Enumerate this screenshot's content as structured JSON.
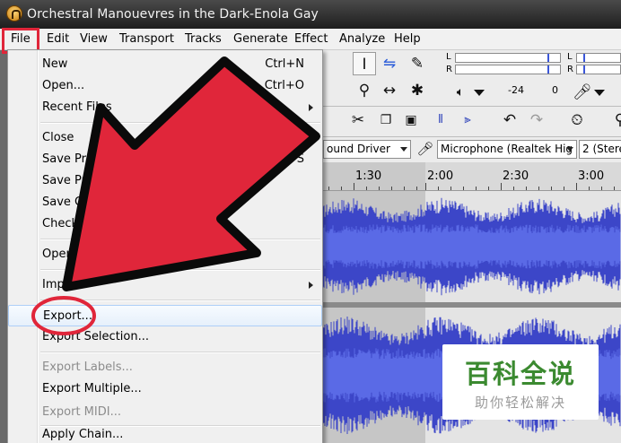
{
  "window": {
    "title": "Orchestral Manouevres in the Dark-Enola Gay"
  },
  "menubar": {
    "items": [
      "File",
      "Edit",
      "View",
      "Transport",
      "Tracks",
      "Generate",
      "Effect",
      "Analyze",
      "Help"
    ]
  },
  "file_menu": {
    "items": [
      {
        "label": "New",
        "shortcut": "Ctrl+N",
        "enabled": true
      },
      {
        "label": "Open...",
        "shortcut": "Ctrl+O",
        "enabled": true
      },
      {
        "label": "Recent Files",
        "submenu": true,
        "enabled": true
      },
      {
        "label": "Close",
        "shortcut": "Ctrl+W",
        "enabled": true
      },
      {
        "label": "Save Project",
        "shortcut": "Ctrl+S",
        "enabled": true
      },
      {
        "label": "Save Proje",
        "enabled": true
      },
      {
        "label": "Save Com",
        "enabled": true
      },
      {
        "label": "Check D",
        "enabled": true
      },
      {
        "label": "Open M",
        "enabled": true
      },
      {
        "label": "Impo",
        "submenu": true,
        "enabled": true
      },
      {
        "label": "Export...",
        "enabled": true,
        "highlighted": true
      },
      {
        "label": "Export Selection...",
        "enabled": true
      },
      {
        "label": "Export Labels...",
        "enabled": false
      },
      {
        "label": "Export Multiple...",
        "enabled": true
      },
      {
        "label": "Export MIDI...",
        "enabled": false
      },
      {
        "label": "Apply Chain...",
        "enabled": true
      }
    ]
  },
  "toolbar": {
    "meter_l": "L",
    "meter_r": "R",
    "gain_min": "-24",
    "gain_max": "0",
    "host_dropdown": "ound Driver",
    "input_device": "Microphone (Realtek Hig",
    "channels": "2 (Stereo"
  },
  "timeline": {
    "labels": [
      "1:30",
      "2:00",
      "2:30",
      "3:00"
    ]
  },
  "watermark": {
    "title": "百科全说",
    "subtitle": "助你轻松解决"
  },
  "colors": {
    "waveform": "#3c46c8",
    "annotation_red": "#e0263a",
    "watermark_green": "#3b8a30"
  }
}
